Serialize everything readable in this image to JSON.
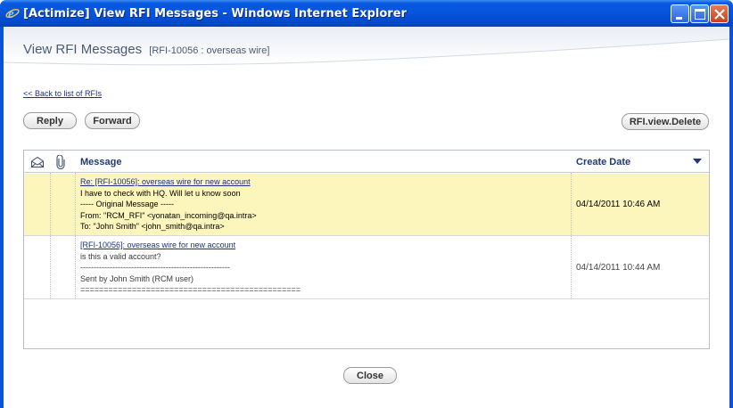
{
  "window": {
    "title": "[Actimize] View RFI Messages - Windows Internet Explorer"
  },
  "page": {
    "title": "View RFI Messages",
    "subtitle": "[RFI-10056 : overseas wire]",
    "back_link": "<< Back to list of RFIs"
  },
  "toolbar": {
    "reply_label": "Reply",
    "forward_label": "Forward",
    "delete_label": "RFI.view.Delete"
  },
  "grid": {
    "columns": {
      "envelope_icon": "envelope-icon",
      "attachment_icon": "paperclip-icon",
      "message": "Message",
      "create_date": "Create Date"
    },
    "sort_direction": "descending",
    "rows": [
      {
        "selected": true,
        "subject": "Re: [RFI-10056]: overseas wire for new account",
        "lines": [
          "I have to check with HQ. Will let u know soon",
          "----- Original Message -----",
          "From: \"RCM_RFI\" <yonatan_incoming@qa.intra>",
          "To: \"John Smith\" <john_smith@qa.intra>"
        ],
        "date": "04/14/2011 10:46 AM"
      },
      {
        "selected": false,
        "subject": "[RFI-10056]: overseas wire for new account",
        "lines": [
          "is this a valid account?",
          "--------------------------------------------------------",
          "Sent by John Smith (RCM user)",
          "==============================================="
        ],
        "date": "04/14/2011 10:44 AM"
      }
    ]
  },
  "footer": {
    "close_label": "Close"
  },
  "colors": {
    "titlebar_blue": "#0554db",
    "selected_row": "#fcf6bd",
    "header_text": "#1f3a77",
    "link": "#1a2f8a"
  }
}
